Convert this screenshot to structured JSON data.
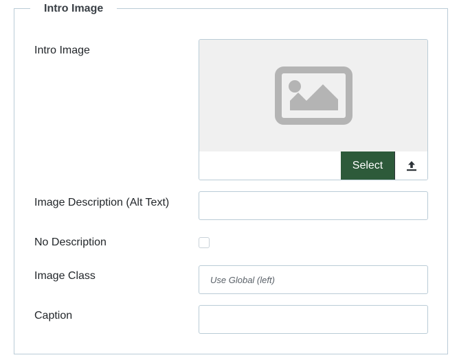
{
  "fieldset": {
    "legend": "Intro Image"
  },
  "fields": {
    "intro_image": {
      "label": "Intro Image",
      "placeholder_icon": "image-placeholder-icon",
      "path_value": "",
      "select_label": "Select",
      "upload_icon": "upload-icon"
    },
    "image_description": {
      "label": "Image Description (Alt Text)",
      "value": ""
    },
    "no_description": {
      "label": "No Description",
      "checked": false
    },
    "image_class": {
      "label": "Image Class",
      "value": "",
      "placeholder": "Use Global (left)"
    },
    "caption": {
      "label": "Caption",
      "value": ""
    }
  },
  "colors": {
    "select_button_bg": "#2d5a3a",
    "border": "#b9cbd6",
    "preview_bg": "#f0f0f0",
    "icon_gray": "#b4b4b4"
  }
}
